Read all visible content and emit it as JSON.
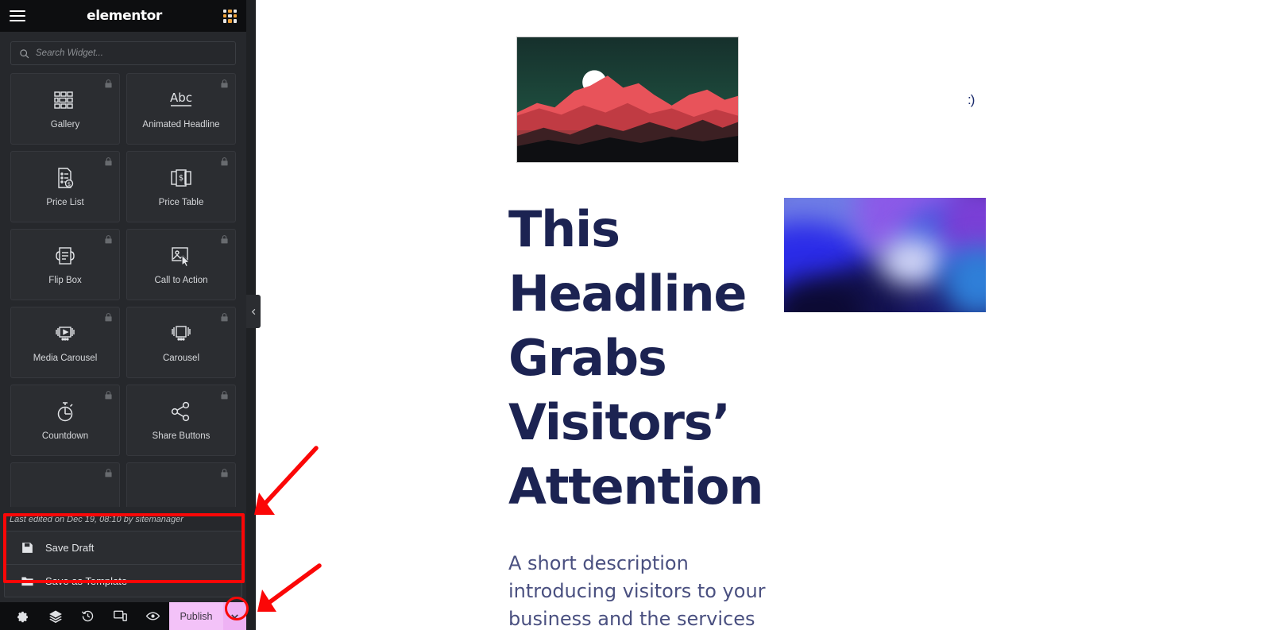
{
  "app": {
    "brand": "elementor",
    "menu_icon": "hamburger-icon",
    "apps_icon": "grid-apps-icon"
  },
  "search": {
    "placeholder": "Search Widget...",
    "value": "",
    "icon": "search-icon"
  },
  "widgets": {
    "items": [
      {
        "label": "Gallery",
        "icon": "gallery-grid-icon",
        "locked": true
      },
      {
        "label": "Animated Headline",
        "icon": "abc-underline-icon",
        "locked": true
      },
      {
        "label": "Price List",
        "icon": "price-list-icon",
        "locked": true
      },
      {
        "label": "Price Table",
        "icon": "price-table-icon",
        "locked": true
      },
      {
        "label": "Flip Box",
        "icon": "flip-box-icon",
        "locked": true
      },
      {
        "label": "Call to Action",
        "icon": "call-to-action-icon",
        "locked": true
      },
      {
        "label": "Media Carousel",
        "icon": "media-carousel-icon",
        "locked": true
      },
      {
        "label": "Carousel",
        "icon": "carousel-icon",
        "locked": true
      },
      {
        "label": "Countdown",
        "icon": "countdown-stopwatch-icon",
        "locked": true
      },
      {
        "label": "Share Buttons",
        "icon": "share-nodes-icon",
        "locked": true
      },
      {
        "label": "",
        "icon": "lock-icon",
        "locked": true
      },
      {
        "label": "",
        "icon": "lock-icon",
        "locked": true
      }
    ]
  },
  "footer": {
    "last_edited": "Last edited on Dec 19, 08:10 by sitemanager",
    "save_menu": [
      {
        "label": "Save Draft",
        "icon": "floppy-disk-icon"
      },
      {
        "label": "Save as Template",
        "icon": "folder-icon"
      }
    ],
    "toolbar": [
      {
        "name": "settings",
        "icon": "gear-icon"
      },
      {
        "name": "navigator",
        "icon": "layers-icon"
      },
      {
        "name": "history",
        "icon": "history-clock-icon"
      },
      {
        "name": "responsive",
        "icon": "responsive-devices-icon"
      },
      {
        "name": "preview",
        "icon": "eye-preview-icon"
      }
    ],
    "publish_label": "Publish",
    "publish_caret_icon": "chevron-down-icon"
  },
  "collapse": {
    "icon": "chevron-left-icon"
  },
  "canvas": {
    "hero_image_alt": "red mountains at dusk with white moon",
    "smiley": ":)",
    "headline": "This Headline Grabs Visitors’ Attention",
    "abstract_image_alt": "blue purple abstract fluid gradient",
    "description": "A short description introducing visitors to your business and the services"
  },
  "annotations": {
    "highlight_color": "#fb0707",
    "arrow_to_save_menu": "arrow-pointing-to-save-menu",
    "arrow_to_publish_caret": "arrow-pointing-to-publish-dropdown",
    "box_around_save_menu": "red-box-save-menu",
    "circle_around_caret": "red-circle-publish-caret"
  },
  "colors": {
    "panel_bg": "#26282c",
    "header_bg": "#0d0e10",
    "publish_bg": "#f3c2f8",
    "headline": "#1c2352",
    "description": "#4a5080",
    "accent_red": "#fb0707"
  }
}
